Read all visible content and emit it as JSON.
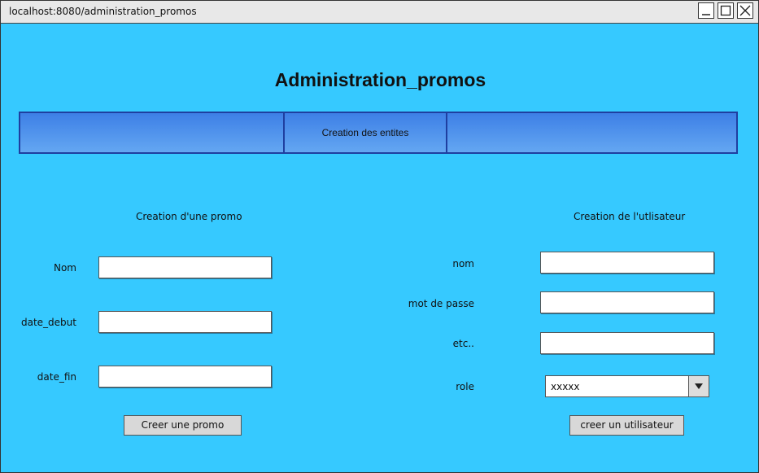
{
  "window": {
    "url": "localhost:8080/administration_promos"
  },
  "page": {
    "title": "Administration_promos"
  },
  "nav": {
    "tabs": [
      {
        "label": ""
      },
      {
        "label": "Creation des entites"
      },
      {
        "label": ""
      }
    ]
  },
  "promo_form": {
    "heading": "Creation d'une promo",
    "fields": [
      {
        "label": "Nom",
        "value": ""
      },
      {
        "label": "date_debut",
        "value": ""
      },
      {
        "label": "date_fin",
        "value": ""
      }
    ],
    "submit_label": "Creer une promo"
  },
  "user_form": {
    "heading": "Creation de l'utlisateur",
    "fields": [
      {
        "label": "nom",
        "value": ""
      },
      {
        "label": "mot de passe",
        "value": ""
      },
      {
        "label": "etc..",
        "value": ""
      }
    ],
    "role_label": "role",
    "role_value": "xxxxx",
    "submit_label": "creer un utilisateur"
  }
}
